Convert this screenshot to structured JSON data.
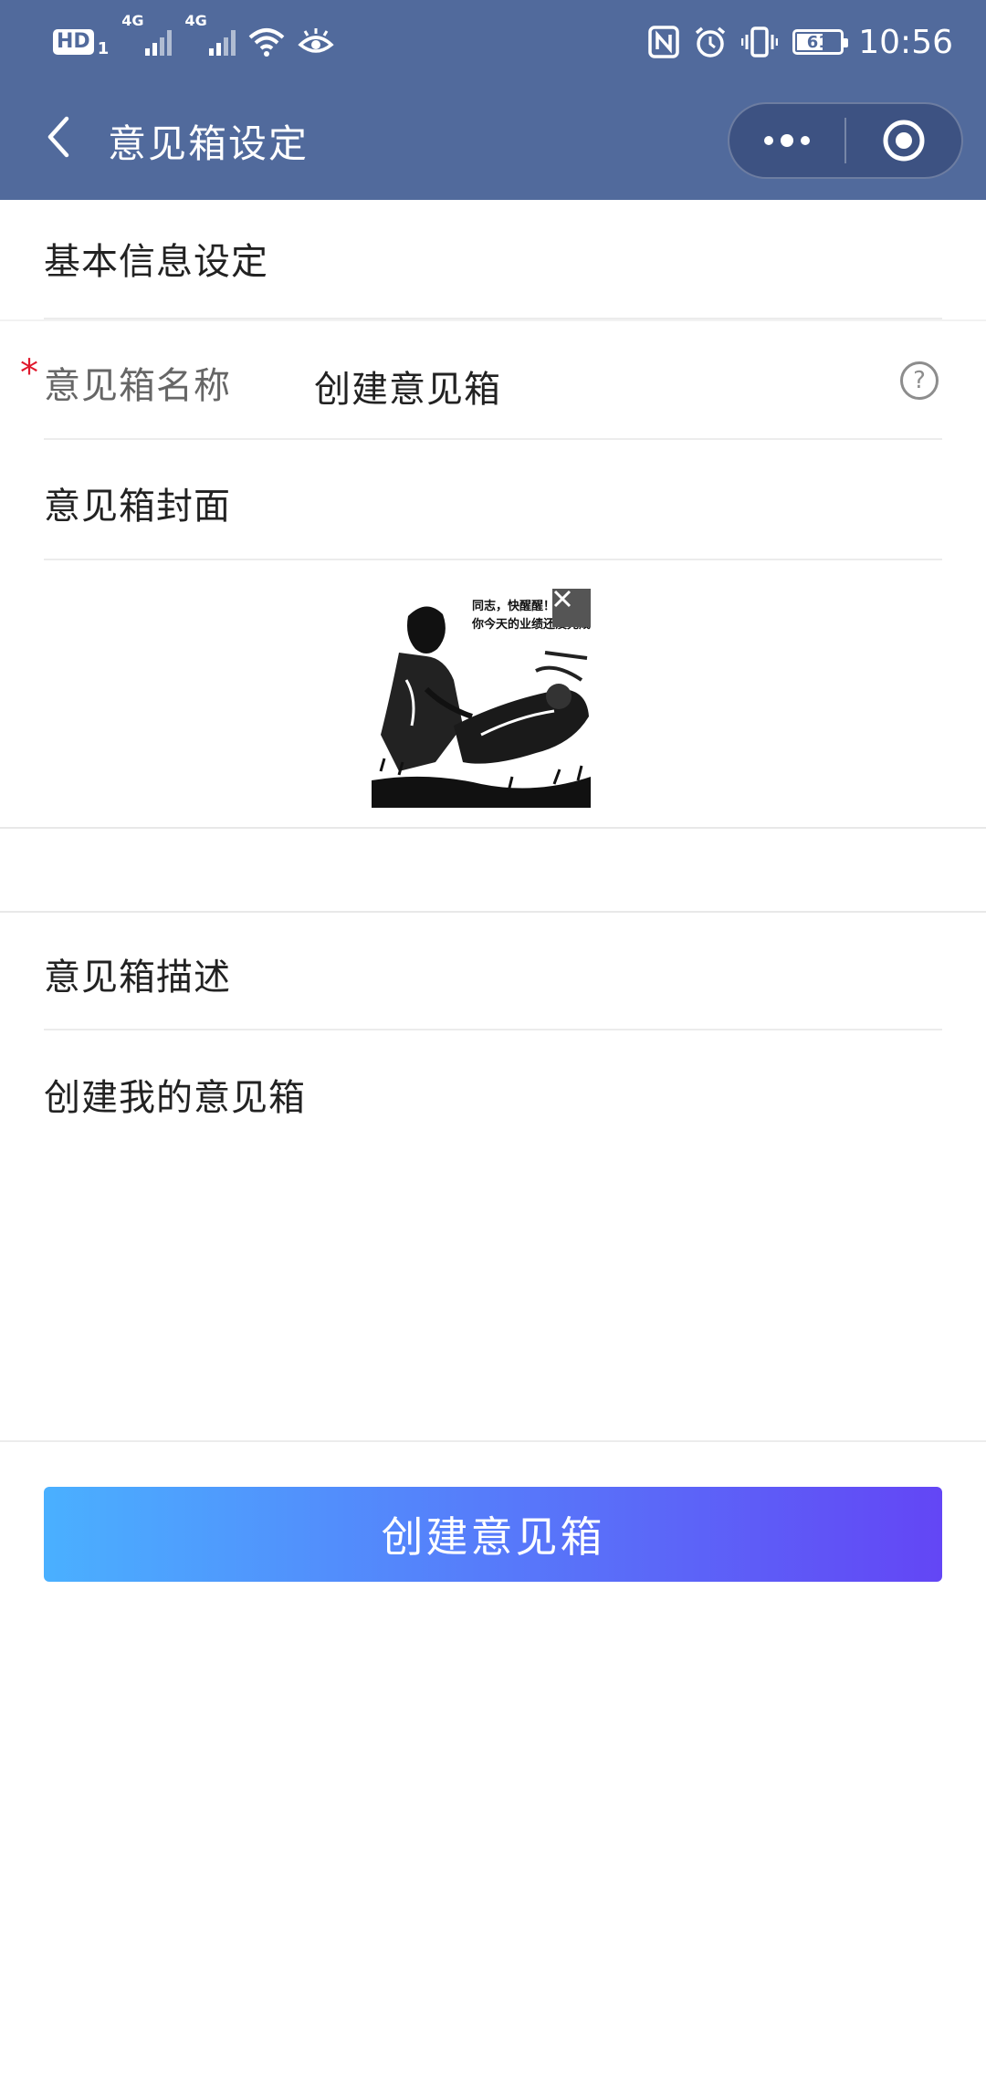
{
  "status_bar": {
    "hd_label": "HD",
    "hd_sub": "1",
    "signal_1_label": "4G",
    "signal_2_label": "4G",
    "battery_level": "61",
    "battery_fraction": 0.61,
    "time": "10:56"
  },
  "navbar": {
    "title": "意见箱设定",
    "back_icon": "chevron-left-icon",
    "more_icon": "more-dots-icon",
    "close_icon": "target-circle-icon"
  },
  "form": {
    "section_title": "基本信息设定",
    "name_field": {
      "required_mark": "*",
      "label": "意见箱名称",
      "value": "创建意见箱",
      "help_icon": "?"
    },
    "cover_field": {
      "label": "意见箱封面",
      "image_caption_line1": "同志，快醒醒！",
      "image_caption_line2": "你今天的业绩还没完成"
    },
    "description_field": {
      "label": "意见箱描述",
      "value": "创建我的意见箱"
    },
    "submit_label": "创建意见箱"
  },
  "colors": {
    "header_bg": "#516a9c",
    "required": "#e0192d",
    "button_gradient_start": "#4ab0ff",
    "button_gradient_end": "#6346f5"
  }
}
